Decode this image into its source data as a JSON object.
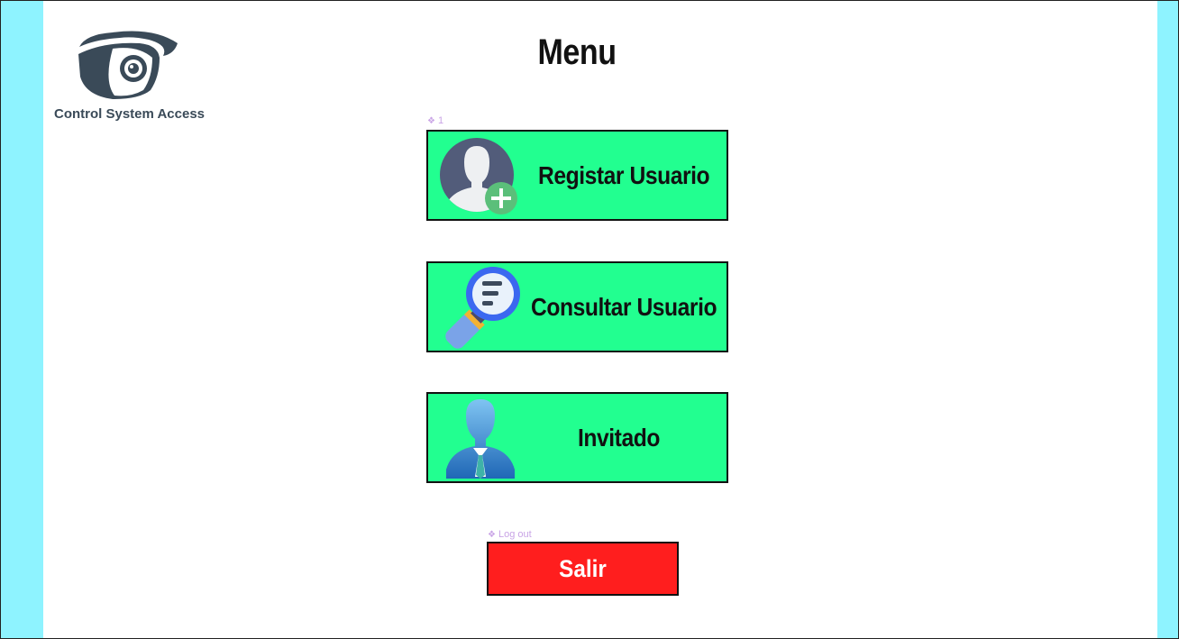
{
  "app": {
    "logo_text": "Control System Access",
    "title": "Menu"
  },
  "annotations": {
    "menu_group": "1",
    "logout_group": "Log out"
  },
  "menu": {
    "items": [
      {
        "label": "Registar Usuario",
        "icon": "user-add-icon"
      },
      {
        "label": "Consultar Usuario",
        "icon": "magnifier-search-icon"
      },
      {
        "label": "Invitado",
        "icon": "guest-user-icon"
      }
    ]
  },
  "logout": {
    "label": "Salir"
  },
  "colors": {
    "background_side": "#8ef3ff",
    "menu_button": "#22ff90",
    "logout_button": "#ff1e1e",
    "logo": "#3a4a58"
  }
}
